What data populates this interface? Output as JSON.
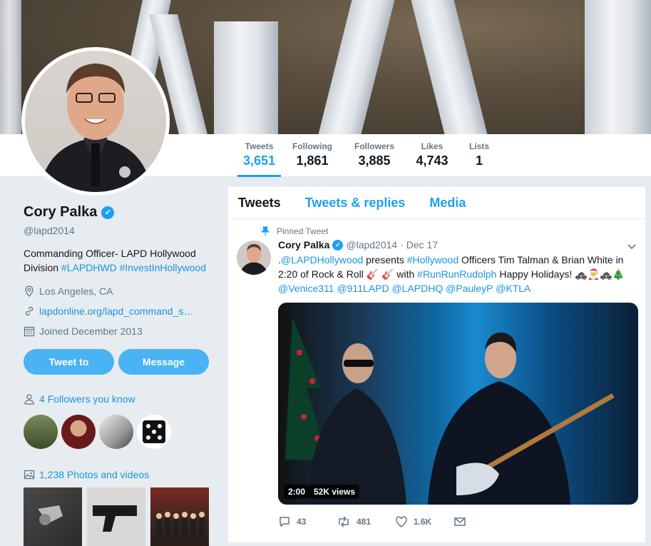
{
  "profile": {
    "name": "Cory Palka",
    "handle": "@lapd2014",
    "bio_text": "Commanding Officer- LAPD Hollywood Division ",
    "bio_tag1": "#LAPDHWD",
    "bio_tag2": "#InvestInHollywood",
    "location": "Los Angeles, CA",
    "website": "lapdonline.org/lapd_command_s…",
    "joined": "Joined December 2013",
    "tweet_to_label": "Tweet to",
    "message_label": "Message",
    "followers_you_know": "4 Followers you know",
    "photos_videos": "1,238 Photos and videos"
  },
  "stats": [
    {
      "label": "Tweets",
      "value": "3,651"
    },
    {
      "label": "Following",
      "value": "1,861"
    },
    {
      "label": "Followers",
      "value": "3,885"
    },
    {
      "label": "Likes",
      "value": "4,743"
    },
    {
      "label": "Lists",
      "value": "1"
    }
  ],
  "tabs": [
    "Tweets",
    "Tweets & replies",
    "Media"
  ],
  "tweet": {
    "pinned_label": "Pinned Tweet",
    "author": "Cory Palka",
    "handle": "@lapd2014",
    "date": "· Dec 17",
    "t1": ".",
    "m1": "@LAPDHollywood",
    "t2": " presents ",
    "h1": "#Hollywood",
    "t3": " Officers Tim Talman & Brian White in 2:20 of Rock & Roll 🎸 🎸  with ",
    "h2": "#RunRunRudolph",
    "t4": " Happy Holidays! 🚓🎅🚓🎄",
    "m2": "@Venice311",
    "m3": "@911LAPD",
    "m4": "@LAPDHQ",
    "m5": "@PauleyP",
    "m6": "@KTLA",
    "duration": "2:00",
    "views": "52K views",
    "replies": "43",
    "retweets": "481",
    "likes": "1.6K"
  },
  "colors": {
    "accent": "#1da1f2",
    "button": "#4ab3f4",
    "link": "#1b95e0",
    "muted": "#657786"
  }
}
